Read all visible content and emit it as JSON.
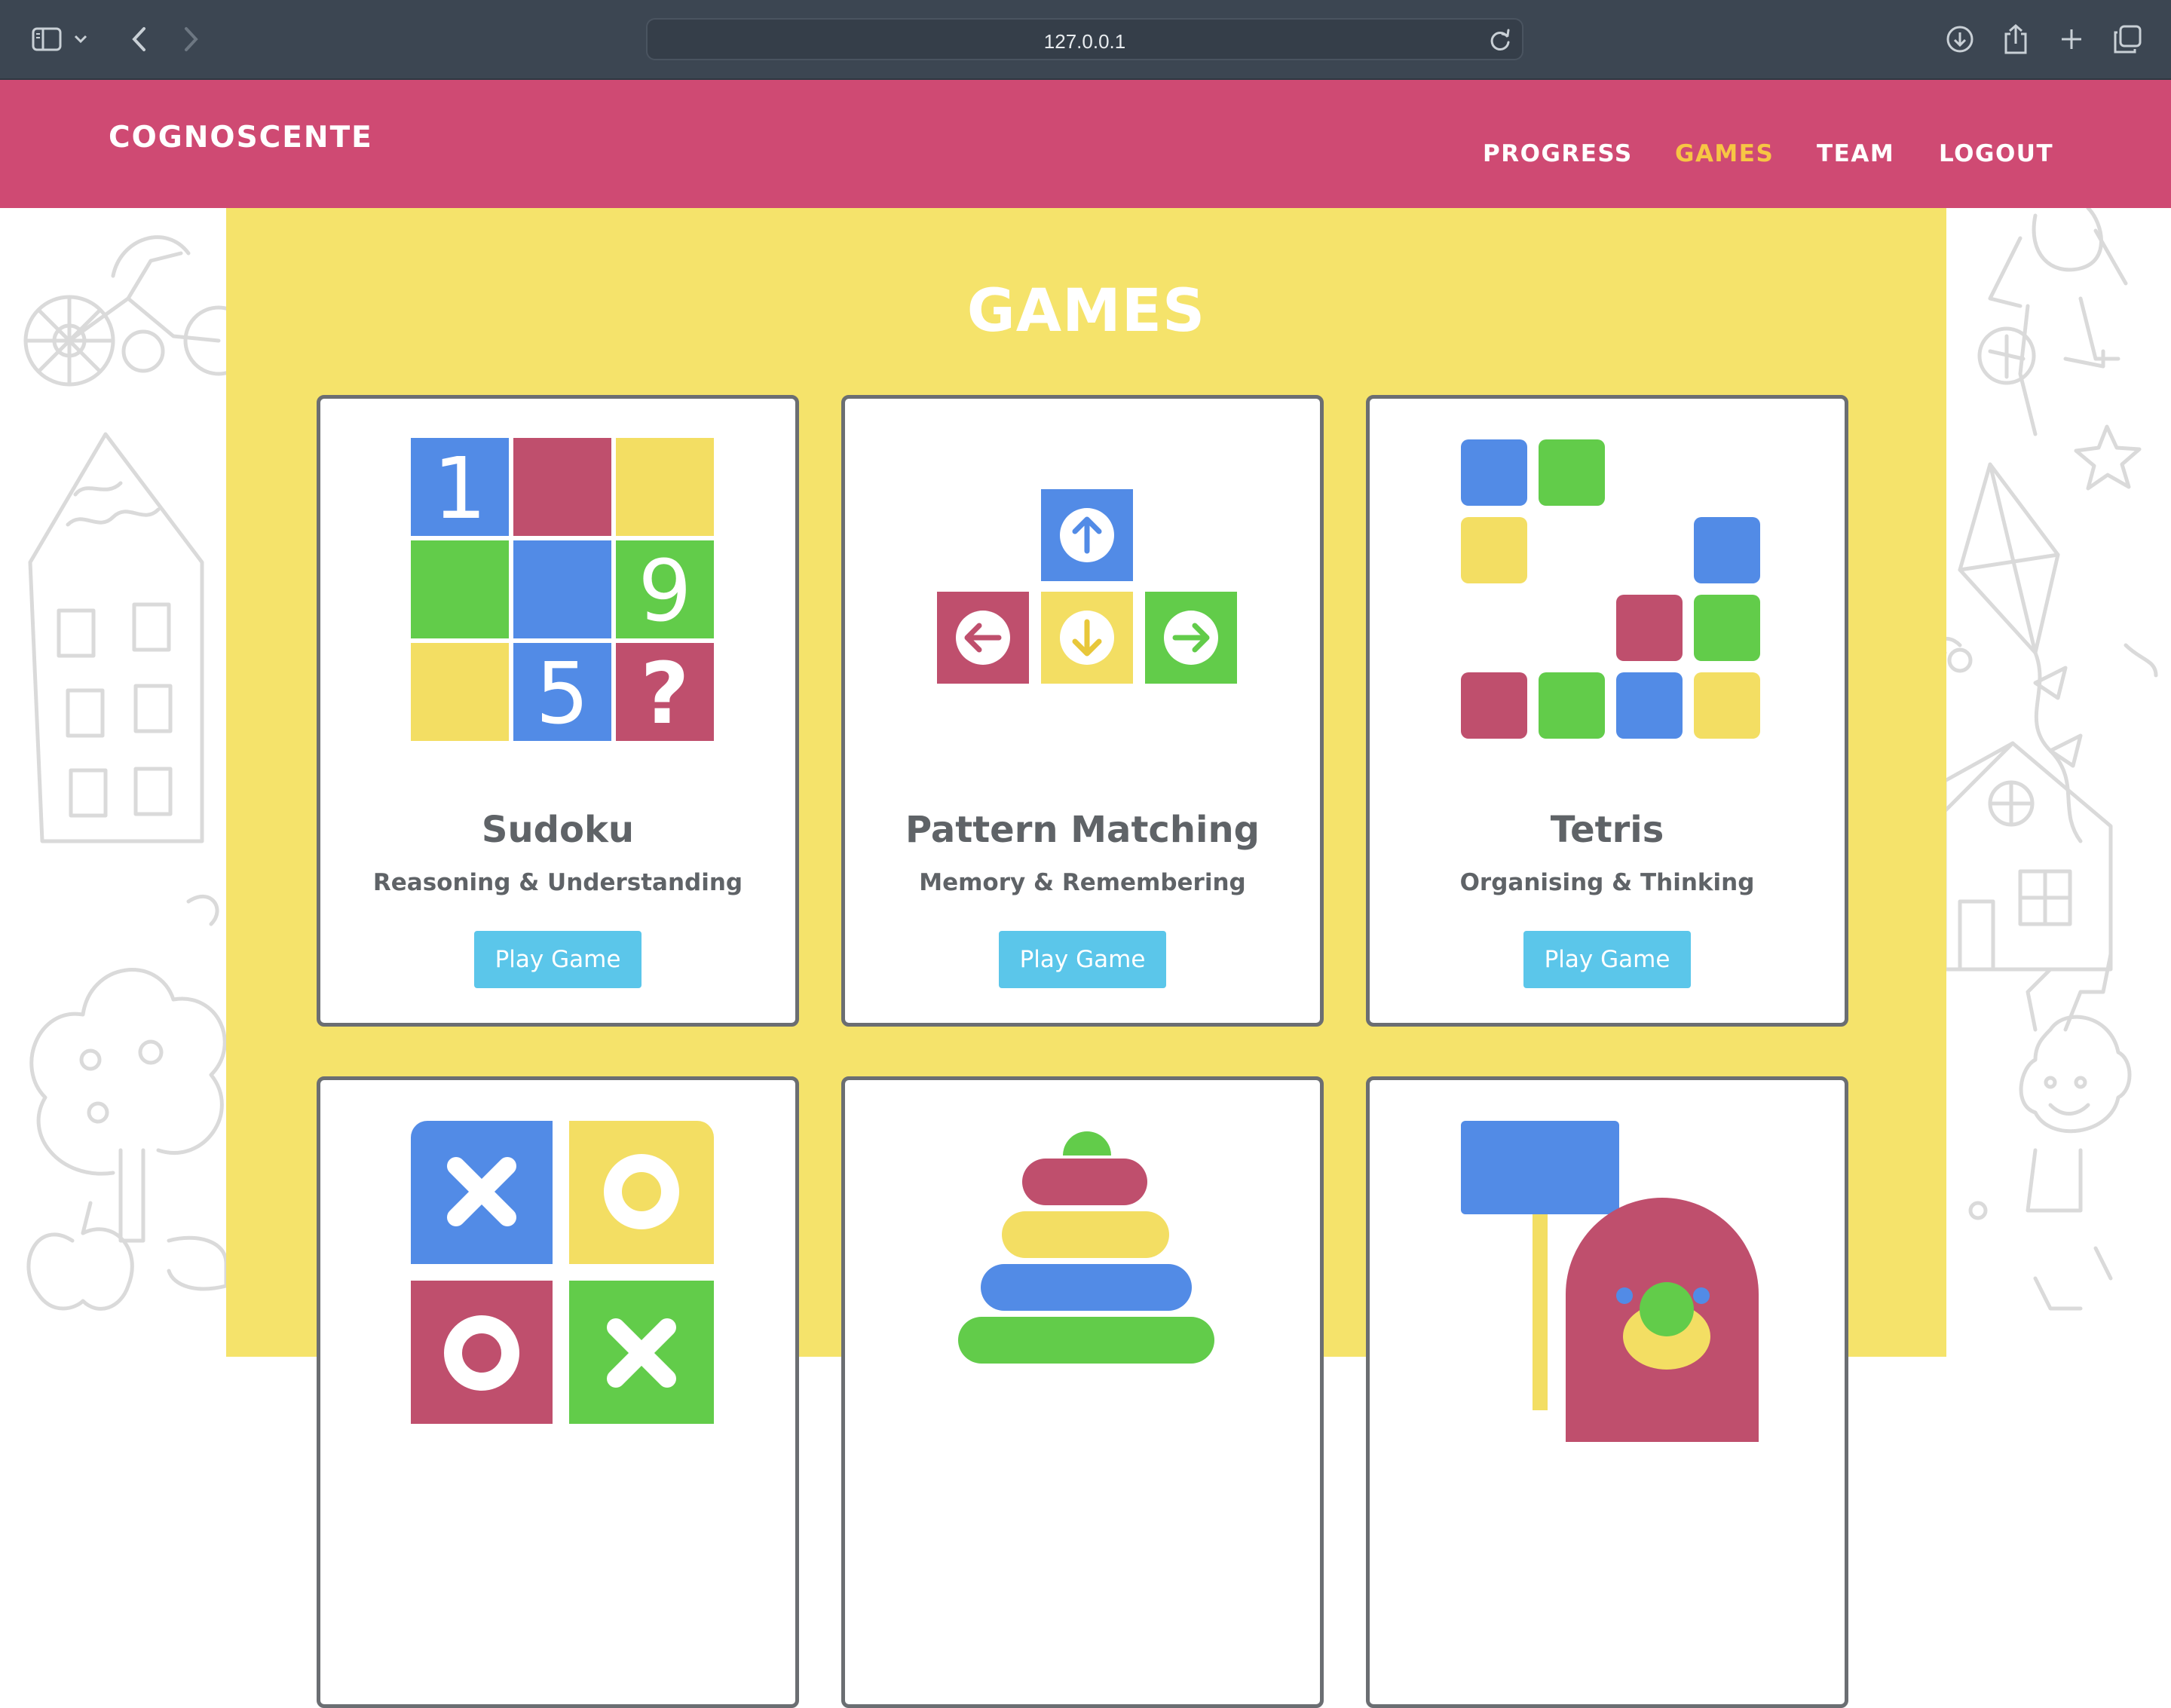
{
  "browser": {
    "url": "127.0.0.1",
    "icons": [
      "sidebar-icon",
      "chevron-down-icon",
      "back-icon",
      "forward-icon",
      "reload-icon",
      "download-icon",
      "share-icon",
      "new-tab-icon",
      "tabs-overview-icon"
    ]
  },
  "header": {
    "brand": "COGNOSCENTE",
    "nav": [
      {
        "label": "PROGRESS",
        "active": false
      },
      {
        "label": "GAMES",
        "active": true
      },
      {
        "label": "TEAM",
        "active": false
      },
      {
        "label": "LOGOUT",
        "active": false
      }
    ],
    "accent_color": "#cf4a73",
    "active_color": "#f7c644"
  },
  "page": {
    "title": "GAMES",
    "panel_color": "#f5e36b"
  },
  "games": [
    {
      "title": "Sudoku",
      "subtitle": "Reasoning & Understanding",
      "button": "Play Game",
      "icon": "sudoku-grid-icon",
      "digits": [
        "1",
        "9",
        "5",
        "?"
      ]
    },
    {
      "title": "Pattern Matching",
      "subtitle": "Memory & Remembering",
      "button": "Play Game",
      "icon": "arrow-keys-icon"
    },
    {
      "title": "Tetris",
      "subtitle": "Organising & Thinking",
      "button": "Play Game",
      "icon": "tetris-blocks-icon"
    },
    {
      "title": "",
      "subtitle": "",
      "button": "",
      "icon": "tic-tac-toe-icon"
    },
    {
      "title": "",
      "subtitle": "",
      "button": "",
      "icon": "ring-stack-icon"
    },
    {
      "title": "",
      "subtitle": "",
      "button": "",
      "icon": "whack-a-mole-icon"
    }
  ],
  "palette": {
    "blue": "#528be6",
    "red": "#bf4f6d",
    "yellow": "#f3de63",
    "green": "#62cc4a",
    "button": "#5bc6ea"
  }
}
